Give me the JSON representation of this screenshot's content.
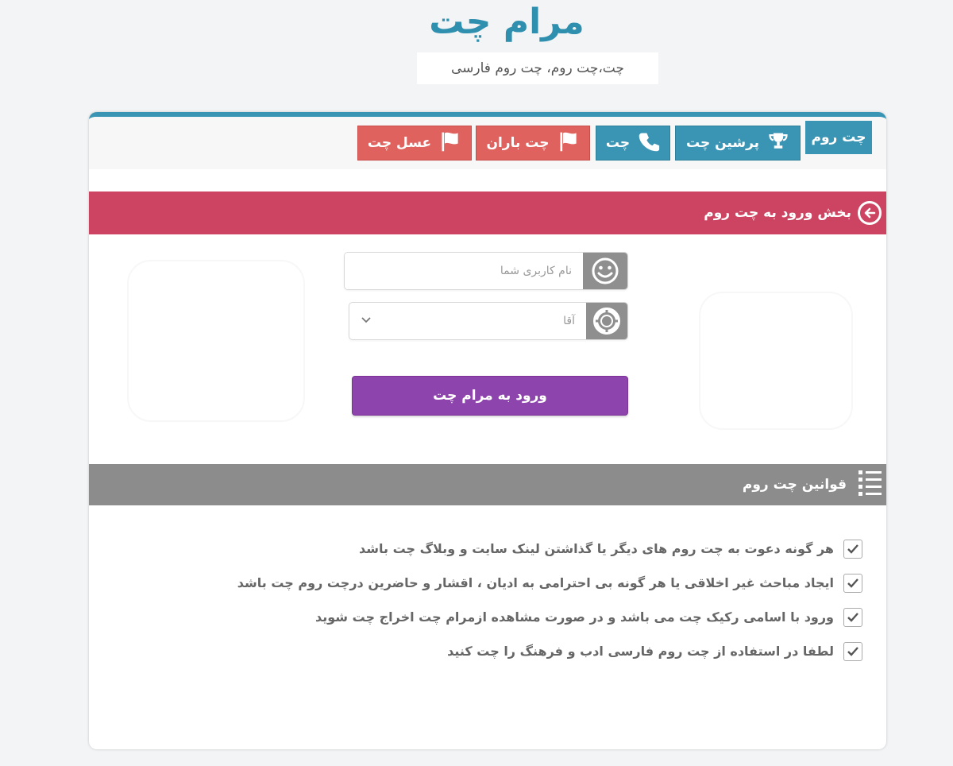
{
  "site": {
    "title": "مرام چت",
    "subtitle": "چت،چت روم، چت روم فارسی"
  },
  "nav": {
    "label": "چت روم",
    "buttons": [
      {
        "label": "پرشین چت",
        "icon": "trophy-icon",
        "color": "#3a95b4"
      },
      {
        "label": "چت",
        "icon": "phone-icon",
        "color": "#3a95b4"
      },
      {
        "label": "چت باران",
        "icon": "flag-icon",
        "color": "#e0625e"
      },
      {
        "label": "عسل چت",
        "icon": "flag-icon",
        "color": "#e0625e"
      }
    ]
  },
  "login": {
    "header": "بخش ورود به چت روم",
    "username_placeholder": "نام کاربری شما",
    "username_icon": "smiley-icon",
    "gender_value": "آقا",
    "gender_icon": "lifebuoy-icon",
    "submit_label": "ورود به مرام چت"
  },
  "rules": {
    "header": "قوانین چت روم",
    "header_icon": "list-icon",
    "items": [
      "هر گونه دعوت به چت روم های دیگر یا گذاشتن لینک سایت و وبلاگ چت باشد",
      "ایجاد مباحث غیر اخلاقی یا هر گونه بی احترامی به ادیان ، اقشار و حاضرین درچت روم چت باشد",
      "ورود با اسامی رکیک چت می باشد و در صورت مشاهده ازمرام چت اخراج چت شوید",
      "لطفا در استفاده از چت روم فارسی ادب و فرهنگ را چت کنید"
    ]
  },
  "colors": {
    "brand_blue": "#3a95b4",
    "nav_red": "#e0625e",
    "login_header": "#cc4461",
    "submit_purple": "#8e44ad",
    "rules_header": "#8c8c8c"
  }
}
